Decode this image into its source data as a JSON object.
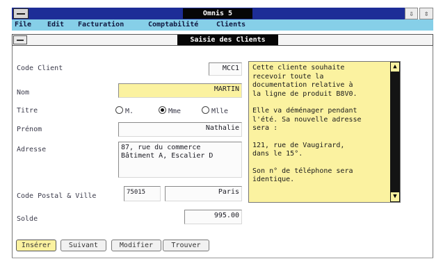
{
  "window": {
    "title": "Omnis 5",
    "min_glyph": "⇩",
    "max_glyph": "⇳"
  },
  "menu": [
    "File",
    "Edit",
    "Facturation",
    "Comptabilité",
    "Clients"
  ],
  "form": {
    "title": "Saisie des Clients",
    "code_client": {
      "label": "Code Client",
      "value": "MCC1"
    },
    "nom": {
      "label": "Nom",
      "value": "MARTIN"
    },
    "titre": {
      "label": "Titre",
      "options": [
        "M.",
        "Mme",
        "Mlle"
      ],
      "selected": "Mme"
    },
    "prenom": {
      "label": "Prénom",
      "value": "Nathalie"
    },
    "adresse": {
      "label": "Adresse",
      "line1": "87, rue du commerce",
      "line2": "Bâtiment A, Escalier D"
    },
    "code_postal_ville": {
      "label": "Code Postal & Ville",
      "code_postal": "75015",
      "ville": "Paris"
    },
    "solde": {
      "label": "Solde",
      "value": "995.00"
    },
    "memo": {
      "paragraphs": [
        "Cette cliente souhaite\nrecevoir toute la\ndocumentation relative à\nla ligne de produit B8V0.",
        "Elle va déménager pendant\nl'été. Sa nouvelle adresse\nsera :",
        "121, rue de Vaugirard,\ndans le 15°.",
        "Son n° de téléphone sera\nidentique."
      ],
      "scroll_up": "▲",
      "scroll_down": "▼"
    },
    "buttons": [
      "Insérer",
      "Suivant",
      "Modifier",
      "Trouver"
    ]
  }
}
